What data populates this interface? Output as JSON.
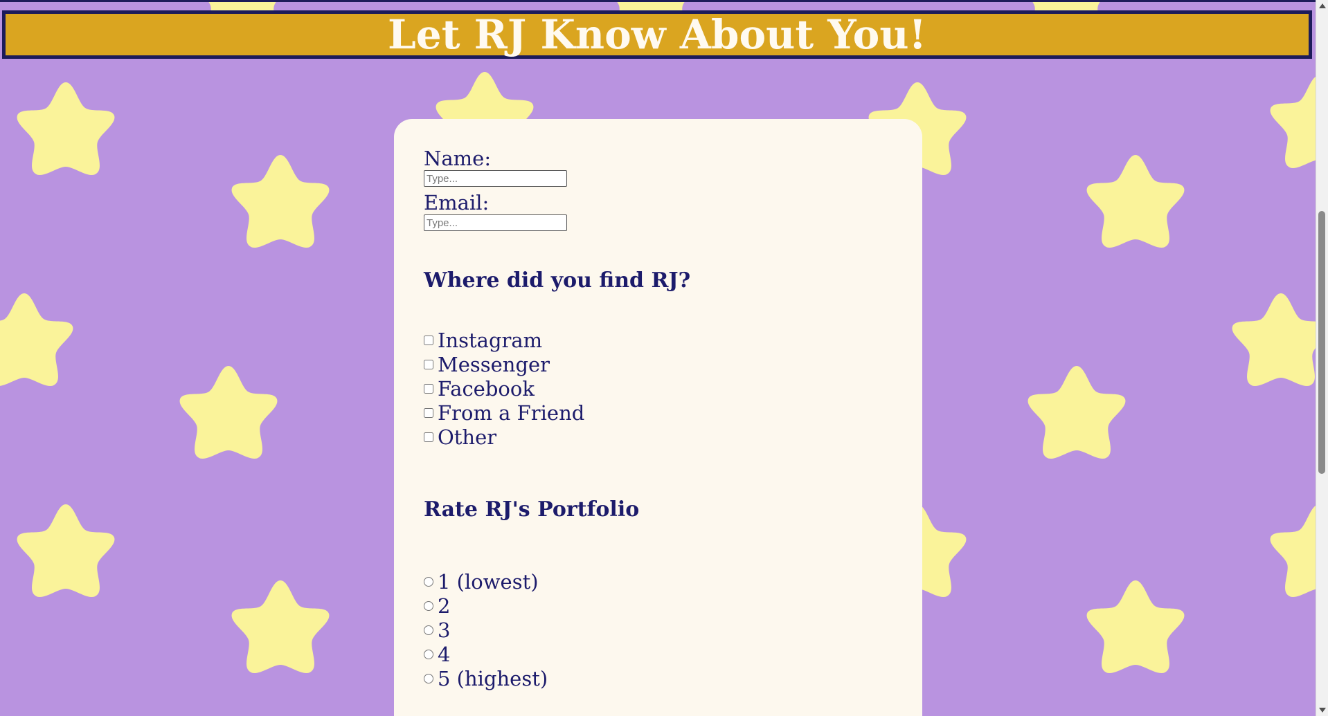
{
  "header": {
    "title": "Let RJ Know About You!"
  },
  "form": {
    "name_label": "Name:",
    "name_placeholder": "Type...",
    "name_value": "",
    "email_label": "Email:",
    "email_placeholder": "Type...",
    "email_value": "",
    "source_heading": "Where did you find RJ?",
    "source_options": [
      {
        "label": "Instagram",
        "checked": false
      },
      {
        "label": "Messenger",
        "checked": false
      },
      {
        "label": "Facebook",
        "checked": false
      },
      {
        "label": "From a Friend",
        "checked": false
      },
      {
        "label": "Other",
        "checked": false
      }
    ],
    "rating_heading": "Rate RJ's Portfolio",
    "rating_options": [
      {
        "label": "1 (lowest)",
        "checked": false
      },
      {
        "label": "2",
        "checked": false
      },
      {
        "label": "3",
        "checked": false
      },
      {
        "label": "4",
        "checked": false
      },
      {
        "label": "5 (highest)",
        "checked": false
      }
    ]
  },
  "colors": {
    "background": "#b993e0",
    "star": "#faf39a",
    "banner": "#daa520",
    "banner_border": "#1c1b5a",
    "banner_text": "#fffaf0",
    "card": "#fdf8ee",
    "text": "#1c1b6b"
  },
  "icons": {
    "background_pattern": "star-icon"
  }
}
